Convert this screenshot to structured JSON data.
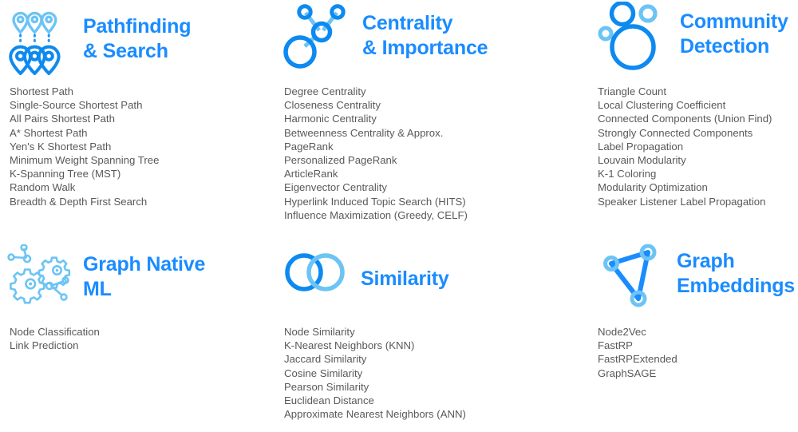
{
  "theme": {
    "background": "#ffffff",
    "title_blue": "#1a8cff",
    "icon_blue": "#0d8af0",
    "icon_blue_light": "#6cc4f5",
    "list_text": "#595959"
  },
  "sections": [
    {
      "id": "pathfinding-and-search",
      "title": "Pathfinding\n& Search",
      "icon": "map-pins-path-icon",
      "items": [
        "Shortest Path",
        "Single-Source Shortest Path",
        "All Pairs Shortest Path",
        "A* Shortest Path",
        "Yen's K Shortest Path",
        "Minimum Weight Spanning Tree",
        "K-Spanning Tree (MST)",
        "Random Walk",
        "Breadth & Depth First Search"
      ]
    },
    {
      "id": "centrality-and-importance",
      "title": "Centrality\n& Importance",
      "icon": "node-graph-centrality-icon",
      "items": [
        "Degree Centrality",
        "Closeness Centrality",
        "Harmonic Centrality",
        "Betweenness Centrality & Approx.",
        "PageRank",
        "Personalized PageRank",
        "ArticleRank",
        "Eigenvector Centrality",
        "Hyperlink Induced Topic Search (HITS)",
        "Influence Maximization (Greedy, CELF)"
      ]
    },
    {
      "id": "community-detection",
      "title": "Community\nDetection",
      "icon": "bubble-clusters-icon",
      "items": [
        "Triangle Count",
        "Local Clustering Coefficient",
        "Connected Components (Union Find)",
        "Strongly Connected Components",
        "Label Propagation",
        "Louvain Modularity",
        "K-1 Coloring",
        "Modularity Optimization",
        "Speaker Listener Label Propagation"
      ]
    },
    {
      "id": "graph-native-ml",
      "title": "Graph Native\nML",
      "icon": "gears-nodes-icon",
      "items": [
        "Node Classification",
        "Link Prediction"
      ]
    },
    {
      "id": "similarity",
      "title": "Similarity",
      "icon": "venn-overlapping-circles-icon",
      "items": [
        "Node Similarity",
        "K-Nearest Neighbors (KNN)",
        "Jaccard Similarity",
        "Cosine Similarity",
        "Pearson Similarity",
        "Euclidean Distance",
        "Approximate Nearest Neighbors (ANN)"
      ]
    },
    {
      "id": "graph-embeddings",
      "title": "Graph\nEmbeddings",
      "icon": "triangle-graph-nodes-icon",
      "items": [
        "Node2Vec",
        "FastRP",
        "FastRPExtended",
        "GraphSAGE"
      ]
    }
  ]
}
